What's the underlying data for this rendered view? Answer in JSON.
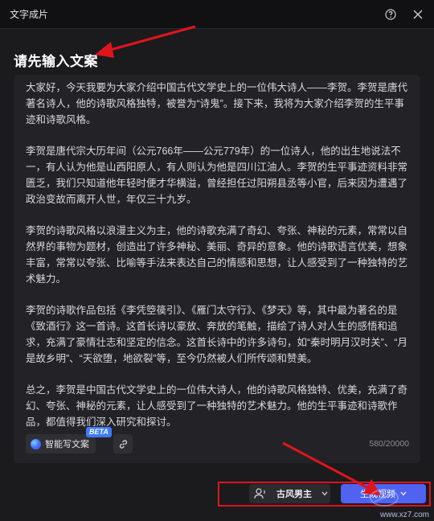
{
  "window": {
    "title": "文字成片",
    "help_icon": "question-circle-icon",
    "close_icon": "close-icon"
  },
  "page": {
    "heading": "请先输入文案"
  },
  "editor": {
    "paragraphs": [
      "大家好，今天我要为大家介绍中国古代文学史上的一位伟大诗人——李贺。李贺是唐代著名诗人，他的诗歌风格独特，被誉为“诗鬼”。接下来，我将为大家介绍李贺的生平事迹和诗歌风格。",
      "李贺是唐代宗大历年间（公元766年——公元779年）的一位诗人，他的出生地说法不一，有人认为他是山西阳原人，有人则认为他是四川江油人。李贺的生平事迹资料非常匮乏，我们只知道他年轻时便才华横溢，曾经担任过阳朔县丞等小官，后来因为遭遇了政治变故而离开人世，年仅三十九岁。",
      "李贺的诗歌风格以浪漫主义为主，他的诗歌充满了奇幻、夸张、神秘的元素，常常以自然界的事物为题材，创造出了许多神秘、美丽、奇异的意象。他的诗歌语言优美，想象丰富，常常以夸张、比喻等手法来表达自己的情感和思想，让人感受到了一种独特的艺术魅力。",
      "李贺的诗歌作品包括《李凭箜篌引》、《雁门太守行》、《梦天》等，其中最为著名的是《致酒行》这一首诗。这首长诗以豪放、奔放的笔触，描绘了诗人对人生的感悟和追求，充满了豪情壮志和坚定的信念。这首长诗中的许多诗句，如“秦时明月汉时关”、“月是故乡明”、“天欲堕，地欲裂”等，至今仍然被人们所传颂和赞美。",
      "总之，李贺是中国古代文学史上的一位伟大诗人，他的诗歌风格独特、优美，充满了奇幻、夸张、神秘的元素，让人感受到了一种独特的艺术魅力。他的生平事迹和诗歌作品，都值得我们深入研究和探讨。"
    ],
    "ai_write_label": "智能写文案",
    "ai_badge": "BETA",
    "link_icon": "link-icon",
    "char_count": "580/20000"
  },
  "footer": {
    "voice_label": "古风男主",
    "voice_icon": "voice-avatar-icon",
    "generate_label": "生成视频",
    "chevron_icon": "chevron-down-icon"
  },
  "watermark": {
    "text": "www.xz7.com"
  },
  "colors": {
    "background": "#1b1b1e",
    "editor_bg": "#232327",
    "accent": "#4f62f0",
    "annotation_red": "#e0141c"
  }
}
